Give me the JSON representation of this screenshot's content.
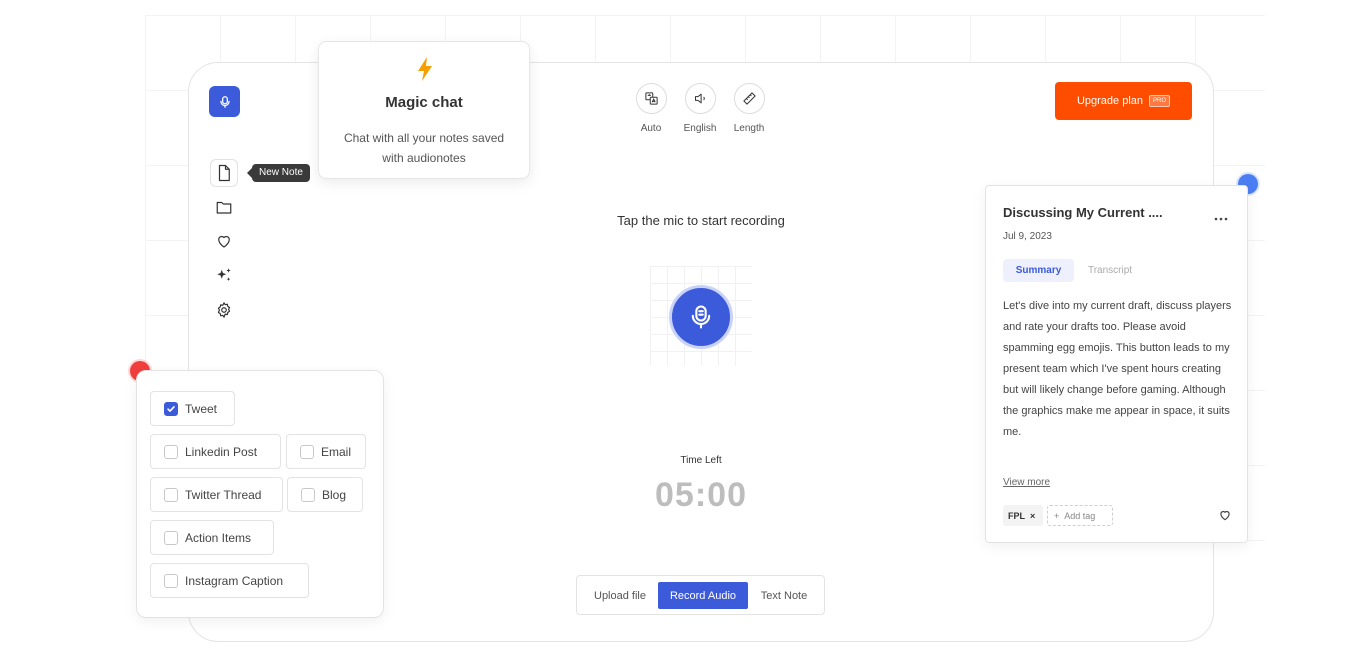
{
  "sidebar": {
    "logo_icon": "microphone-icon",
    "items": [
      {
        "name": "new-note",
        "icon": "document-icon"
      },
      {
        "name": "folders",
        "icon": "folder-icon"
      },
      {
        "name": "favorites",
        "icon": "heart-icon"
      },
      {
        "name": "magic",
        "icon": "sparkles-icon"
      },
      {
        "name": "settings",
        "icon": "gear-icon"
      }
    ],
    "tooltip": "New Note"
  },
  "magic_chat": {
    "icon": "lightning-icon",
    "title": "Magic chat",
    "description": "Chat with all your notes saved with audionotes"
  },
  "toolbar": {
    "tools": [
      {
        "label": "Auto",
        "icon": "translate-icon"
      },
      {
        "label": "English",
        "icon": "speaker-icon"
      },
      {
        "label": "Length",
        "icon": "ruler-icon"
      }
    ],
    "upgrade_label": "Upgrade plan",
    "upgrade_badge": "PRO"
  },
  "recorder": {
    "prompt": "Tap the mic to start recording",
    "time_left_label": "Time Left",
    "timer": "05:00",
    "modes": [
      "Upload file",
      "Record Audio",
      "Text Note"
    ],
    "active_mode": "Record Audio"
  },
  "formats": [
    {
      "label": "Tweet",
      "checked": true
    },
    {
      "label": "Linkedin Post",
      "checked": false
    },
    {
      "label": "Email",
      "checked": false
    },
    {
      "label": "Twitter Thread",
      "checked": false
    },
    {
      "label": "Blog",
      "checked": false
    },
    {
      "label": "Action Items",
      "checked": false
    },
    {
      "label": "Instagram Caption",
      "checked": false
    }
  ],
  "note_card": {
    "title": "Discussing My Current ....",
    "date": "Jul 9, 2023",
    "tabs": [
      "Summary",
      "Transcript"
    ],
    "active_tab": "Summary",
    "body": "Let's dive into my current draft, discuss players and rate your drafts too. Please avoid spamming egg emojis. This button leads to my present team which I've spent hours creating but will likely change before gaming. Although the graphics make me appear in space, it suits me.",
    "view_more": "View more",
    "tags": [
      "FPL"
    ],
    "add_tag": "Add tag"
  },
  "colors": {
    "primary": "#3b5bdb",
    "upgrade": "#ff4d00",
    "dot_red": "#f03e3e",
    "dot_blue": "#4c7ef3"
  }
}
